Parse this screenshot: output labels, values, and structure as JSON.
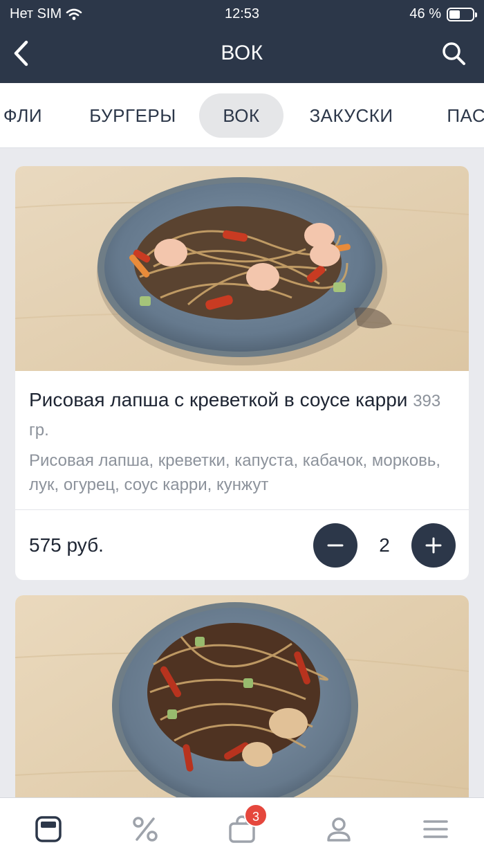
{
  "status_bar": {
    "carrier": "Нет SIM",
    "time": "12:53",
    "battery": "46 %",
    "battery_level": 0.46
  },
  "header": {
    "title": "ВОК"
  },
  "tabs": [
    {
      "label": "ФЛИ",
      "active": false
    },
    {
      "label": "БУРГЕРЫ",
      "active": false
    },
    {
      "label": "ВОК",
      "active": true
    },
    {
      "label": "ЗАКУСКИ",
      "active": false
    },
    {
      "label": "ПАСТ",
      "active": false
    }
  ],
  "products": [
    {
      "name": "Рисовая лапша с креветкой в соусе карри",
      "weight": "393 гр.",
      "description": "Рисовая лапша, креветки, капуста, кабачок, морковь, лук, огурец, соус карри, кунжут",
      "price": "575 руб.",
      "quantity": "2"
    }
  ],
  "bottom_nav": {
    "items": [
      "menu-icon",
      "percent-icon",
      "cart-icon",
      "profile-icon",
      "hamburger-icon"
    ],
    "cart_badge": "3"
  },
  "colors": {
    "primary": "#2c3749",
    "badge": "#e5473d",
    "background": "#e9eaee"
  }
}
